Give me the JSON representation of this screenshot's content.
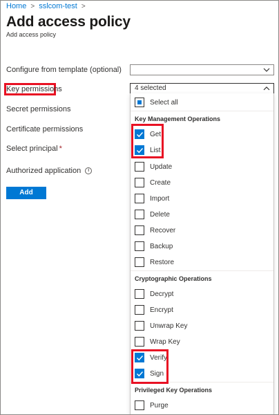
{
  "breadcrumb": {
    "home": "Home",
    "vault": "sslcom-test"
  },
  "page": {
    "title": "Add access policy",
    "subtitle": "Add access policy"
  },
  "form": {
    "template_label": "Configure from template (optional)",
    "template_value": "",
    "key_permissions_label": "Key permissions",
    "key_permissions_value": "4 selected",
    "secret_permissions_label": "Secret permissions",
    "certificate_permissions_label": "Certificate permissions",
    "select_principal_label": "Select principal",
    "required_mark": "*",
    "authorized_application_label": "Authorized application",
    "info_glyph": "i"
  },
  "add_button": "Add",
  "key_permissions_list": {
    "select_all": {
      "label": "Select all",
      "state": "partial"
    },
    "groups": [
      {
        "header": "Key Management Operations",
        "items": [
          {
            "label": "Get",
            "checked": true
          },
          {
            "label": "List",
            "checked": true
          },
          {
            "label": "Update",
            "checked": false
          },
          {
            "label": "Create",
            "checked": false
          },
          {
            "label": "Import",
            "checked": false
          },
          {
            "label": "Delete",
            "checked": false
          },
          {
            "label": "Recover",
            "checked": false
          },
          {
            "label": "Backup",
            "checked": false
          },
          {
            "label": "Restore",
            "checked": false
          }
        ]
      },
      {
        "header": "Cryptographic Operations",
        "items": [
          {
            "label": "Decrypt",
            "checked": false
          },
          {
            "label": "Encrypt",
            "checked": false
          },
          {
            "label": "Unwrap Key",
            "checked": false
          },
          {
            "label": "Wrap Key",
            "checked": false
          },
          {
            "label": "Verify",
            "checked": true
          },
          {
            "label": "Sign",
            "checked": true
          }
        ]
      },
      {
        "header": "Privileged Key Operations",
        "items": [
          {
            "label": "Purge",
            "checked": false
          }
        ]
      }
    ]
  },
  "colors": {
    "accent": "#0078d4",
    "highlight": "#e81123"
  }
}
